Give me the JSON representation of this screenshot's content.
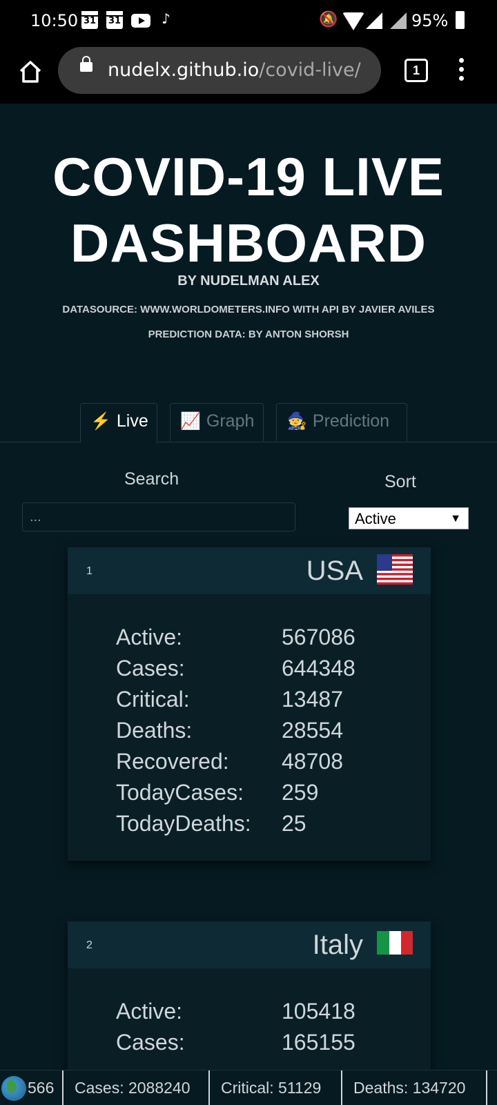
{
  "status_bar": {
    "time": "10:50",
    "calendar_day_1": "31",
    "calendar_day_2": "31",
    "battery": "95%"
  },
  "browser": {
    "url_host": "nudelx.github.io",
    "url_path": "/covid-live/",
    "tab_count": "1"
  },
  "header": {
    "title": "COVID-19 LIVE DASHBOARD",
    "byline": "BY NUDELMAN ALEX",
    "datasource": "DATASOURCE: WWW.WORLDOMETERS.INFO WITH API BY JAVIER AVILES",
    "prediction": "PREDICTION DATA: BY ANTON SHORSH"
  },
  "tabs": [
    {
      "icon": "⚡",
      "label": "Live",
      "active": true
    },
    {
      "icon": "📈",
      "label": "Graph",
      "active": false
    },
    {
      "icon": "🧙",
      "label": "Prediction",
      "active": false
    }
  ],
  "search": {
    "label": "Search",
    "placeholder": "..."
  },
  "sort": {
    "label": "Sort",
    "selected": "Active"
  },
  "cards": [
    {
      "rank": "1",
      "country": "USA",
      "stats": [
        {
          "label": "Active:",
          "value": "567086"
        },
        {
          "label": "Cases:",
          "value": "644348"
        },
        {
          "label": "Critical:",
          "value": "13487"
        },
        {
          "label": "Deaths:",
          "value": "28554"
        },
        {
          "label": "Recovered:",
          "value": "48708"
        },
        {
          "label": "TodayCases:",
          "value": "259"
        },
        {
          "label": "TodayDeaths:",
          "value": "25"
        }
      ]
    },
    {
      "rank": "2",
      "country": "Italy",
      "stats": [
        {
          "label": "Active:",
          "value": "105418"
        },
        {
          "label": "Cases:",
          "value": "165155"
        }
      ]
    }
  ],
  "footer": {
    "active_partial": "566",
    "cases": "Cases: 2088240",
    "critical": "Critical: 51129",
    "deaths": "Deaths: 134720"
  },
  "colors": {
    "background": "#061a21",
    "card_header": "#0e2a34",
    "card_body": "#0a1e26",
    "inactive_tab_text": "#627981"
  }
}
